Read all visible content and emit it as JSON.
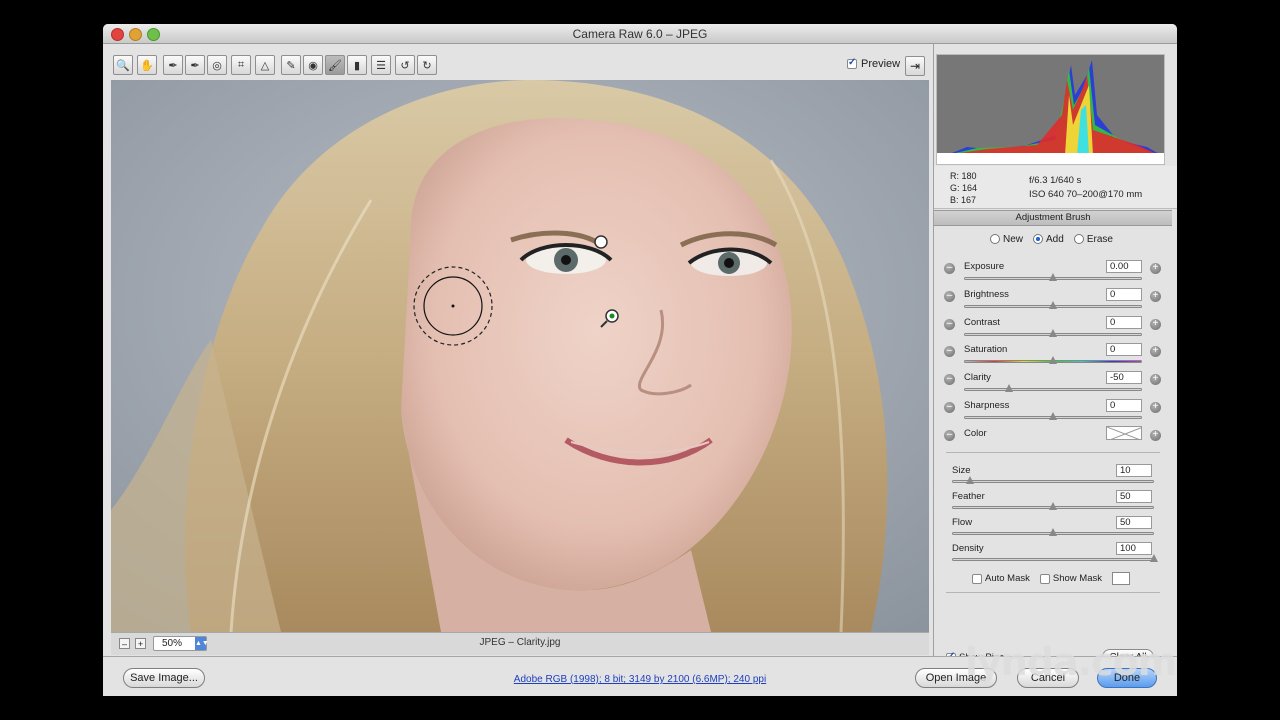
{
  "window": {
    "title": "Camera Raw 6.0  –  JPEG"
  },
  "toolbar": {
    "tools": [
      {
        "name": "zoom-tool-icon",
        "glyph": "🔍"
      },
      {
        "name": "hand-tool-icon",
        "glyph": "✋"
      },
      {
        "name": "white-balance-tool-icon",
        "glyph": "✒"
      },
      {
        "name": "color-sampler-tool-icon",
        "glyph": "✒"
      },
      {
        "name": "targeted-adjustment-tool-icon",
        "glyph": "◎"
      },
      {
        "name": "crop-tool-icon",
        "glyph": "⌗"
      },
      {
        "name": "straighten-tool-icon",
        "glyph": "△"
      },
      {
        "name": "spot-removal-tool-icon",
        "glyph": "✎"
      },
      {
        "name": "red-eye-removal-icon",
        "glyph": "◉"
      },
      {
        "name": "adjustment-brush-icon",
        "glyph": "🖌"
      },
      {
        "name": "graduated-filter-icon",
        "glyph": "▮"
      },
      {
        "name": "preferences-icon",
        "glyph": "☰"
      },
      {
        "name": "rotate-left-icon",
        "glyph": "↺"
      },
      {
        "name": "rotate-right-icon",
        "glyph": "↻"
      }
    ],
    "preview_label": "Preview"
  },
  "readout": {
    "r": "R:  180",
    "g": "G:  164",
    "b": "B:  167",
    "aperture_shutter": "f/6.3   1/640 s",
    "iso_lens": "ISO 640   70–200@170 mm"
  },
  "adjustment_brush": {
    "title": "Adjustment Brush",
    "modes": [
      {
        "label": "New",
        "selected": false
      },
      {
        "label": "Add",
        "selected": true
      },
      {
        "label": "Erase",
        "selected": false
      }
    ],
    "sliders": [
      {
        "label": "Exposure",
        "value": "0.00",
        "pos": 0.5
      },
      {
        "label": "Brightness",
        "value": "0",
        "pos": 0.5
      },
      {
        "label": "Contrast",
        "value": "0",
        "pos": 0.5
      },
      {
        "label": "Saturation",
        "value": "0",
        "pos": 0.5
      },
      {
        "label": "Clarity",
        "value": "-50",
        "pos": 0.25
      },
      {
        "label": "Sharpness",
        "value": "0",
        "pos": 0.5
      }
    ],
    "color_label": "Color",
    "brush": [
      {
        "label": "Size",
        "value": "10",
        "pos": 0.09
      },
      {
        "label": "Feather",
        "value": "50",
        "pos": 0.5
      },
      {
        "label": "Flow",
        "value": "50",
        "pos": 0.5
      },
      {
        "label": "Density",
        "value": "100",
        "pos": 1.0
      }
    ],
    "auto_mask_label": "Auto Mask",
    "show_mask_label": "Show Mask",
    "show_pins_label": "Show Pins",
    "clear_all_label": "Clear All"
  },
  "status": {
    "zoom_out": "–",
    "zoom_in": "+",
    "zoom_value": "50%",
    "file_name": "JPEG  –  Clarity.jpg"
  },
  "bottom": {
    "save_image": "Save Image...",
    "workflow": "Adobe RGB (1998); 8 bit; 3149 by 2100 (6.6MP); 240 ppi",
    "open_image": "Open Image",
    "cancel": "Cancel",
    "done": "Done"
  },
  "watermark": "lynda.com"
}
